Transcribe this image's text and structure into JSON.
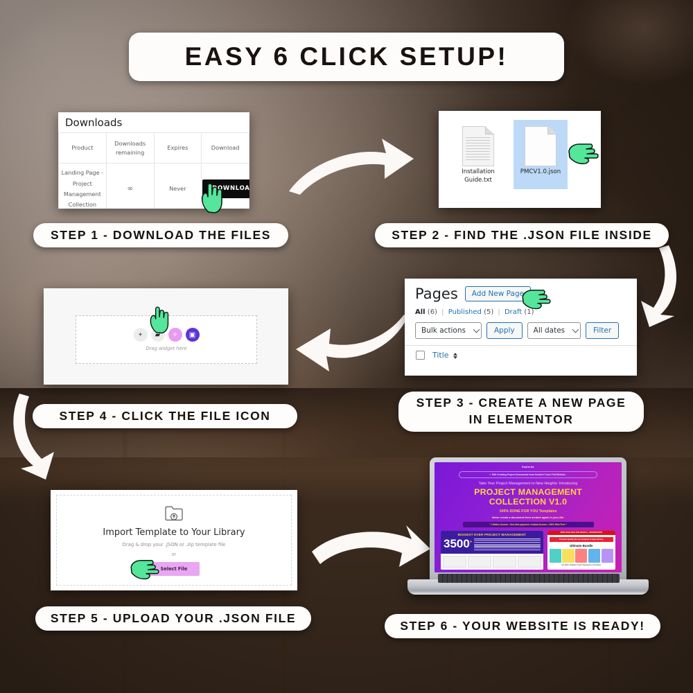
{
  "header": {
    "title": "EASY 6 CLICK SETUP!"
  },
  "steps": [
    {
      "id": 1,
      "label": "STEP 1 - DOWNLOAD THE FILES"
    },
    {
      "id": 2,
      "label": "STEP 2 - FIND THE .JSON FILE INSIDE"
    },
    {
      "id": 3,
      "label": "STEP 3 - CREATE A NEW PAGE IN ELEMENTOR"
    },
    {
      "id": 4,
      "label": "STEP 4 - CLICK THE FILE ICON"
    },
    {
      "id": 5,
      "label": "STEP 5 - UPLOAD YOUR .JSON FILE"
    },
    {
      "id": 6,
      "label": "STEP 6 - YOUR WEBSITE IS READY!"
    }
  ],
  "step1": {
    "heading": "Downloads",
    "columns": [
      "Product",
      "Downloads remaining",
      "Expires",
      "Download"
    ],
    "col_remaining_line1": "Downloads",
    "col_remaining_line2": "remaining",
    "row": {
      "product": "Landing Page - Project Management Collection",
      "remaining": "∞",
      "expires": "Never",
      "download_button": "DOWNLOAD"
    }
  },
  "step2": {
    "files": [
      {
        "name": "Installation Guide.txt",
        "line1": "Installation",
        "line2": "Guide.txt",
        "selected": false
      },
      {
        "name": "PMCV1.0.json",
        "line1": "PMCV1.0.json",
        "line2": "",
        "selected": true
      }
    ]
  },
  "step3": {
    "page_title": "Pages",
    "add_new_button": "Add New Page",
    "filters": [
      {
        "label": "All",
        "count": "(6)",
        "active": true
      },
      {
        "label": "Published",
        "count": "(5)",
        "active": false
      },
      {
        "label": "Draft",
        "count": "(1)",
        "active": false
      }
    ],
    "bulk_actions_value": "Bulk actions",
    "apply_button": "Apply",
    "dates_value": "All dates",
    "filter_button": "Filter",
    "table_header_title": "Title"
  },
  "step4": {
    "drag_text": "Drag widget here",
    "buttons": [
      {
        "name": "add-element",
        "glyph": "+",
        "color": "#ececec"
      },
      {
        "name": "folder",
        "glyph": "▰",
        "color": "#ececec"
      },
      {
        "name": "ai-sparkle",
        "glyph": "✧",
        "color": "#e79bf0"
      },
      {
        "name": "file-upload",
        "glyph": "▣",
        "color": "#5b34d6"
      }
    ]
  },
  "step5": {
    "title": "Import Template to Your Library",
    "subtitle": "Drag & drop your .JSON or .zip template file",
    "or": "or",
    "select_button": "Select File"
  },
  "step6": {
    "screen": {
      "brand": "Scalerite",
      "pill": "✓ Still Creating Project Documents from Scratch? Don't Fall Behind...",
      "pre_line": "Take Your Project Management to New Heights: Introducing",
      "headline_line1": "PROJECT MANAGEMENT",
      "headline_line2": "COLLECTION V1.0",
      "sub_headline_bold": "100% DONE FOR YOU",
      "sub_headline_rest": " Templates",
      "tagline": "Never create a document from scratch again in your life.",
      "feature_bar": "* Lifetime Access • One-time payment • Instant Access • 100% Risk Free *",
      "card_left_title": "BIGGEST EVER PROJECT MANAGEMENT",
      "card_left_number": "3500",
      "card_left_plus": "+",
      "card_right_banner": "NOW AVAILABLE FOR RESALE + DISTRIBUTION",
      "card_right_alert": "Premium quality jobs are designed to keep winning",
      "card_right_title": "Ultimate Bundle",
      "card_right_footer": "Get 3500+ Editable Project Management Templates"
    }
  },
  "arrows": [
    {
      "name": "arrow-step1-to-step2",
      "direction": "right"
    },
    {
      "name": "arrow-step2-to-step3",
      "direction": "down"
    },
    {
      "name": "arrow-step3-to-step4",
      "direction": "left"
    },
    {
      "name": "arrow-step4-to-step5",
      "direction": "down"
    },
    {
      "name": "arrow-step5-to-step6",
      "direction": "right"
    }
  ],
  "colors": {
    "banner_bg": "#fdfcfa",
    "banner_text": "#181210",
    "arrow": "#ffffff",
    "hand_cursor": "#55e69b",
    "wp_blue": "#2271b1",
    "elementor_purple": "#5b34d6",
    "elementor_pink": "#e79bf0",
    "sales_yellow": "#ffd23f",
    "download_btn": "#0c0c0c"
  }
}
